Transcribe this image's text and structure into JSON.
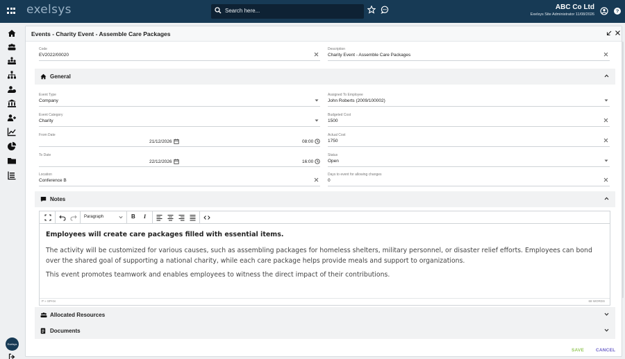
{
  "topbar": {
    "logo": "exelsys",
    "search_placeholder": "Search here...",
    "company_name": "ABC Co Ltd",
    "user_line": "Exelsys Site Administrator 11/08/2026"
  },
  "sidebar": {
    "items": [
      "home-icon",
      "team-icon",
      "org-icon",
      "hierarchy-icon",
      "user-group-icon",
      "bank-icon",
      "user-add-icon",
      "chart-line-icon",
      "pie-chart-icon",
      "folder-icon",
      "list-icon"
    ],
    "avatar_text": "Exelsys"
  },
  "panel": {
    "title": "Events - Charity Event - Assemble Care Packages"
  },
  "fields": {
    "code": {
      "label": "Code",
      "value": "EV2022/00020"
    },
    "description": {
      "label": "Description",
      "value": "Charity Event - Assemble Care Packages"
    },
    "event_type": {
      "label": "Event Type",
      "value": "Company"
    },
    "assigned_to": {
      "label": "Assigned To Employee",
      "value": "John Roberts (2009/100002)"
    },
    "event_category": {
      "label": "Event Category",
      "value": "Charity"
    },
    "budgeted_cost": {
      "label": "Budgeted Cost",
      "value": "1500"
    },
    "from_date": {
      "label": "From Date",
      "date": "21/12/2026",
      "time": "08:00"
    },
    "actual_cost": {
      "label": "Actual Cost",
      "value": "1750"
    },
    "to_date": {
      "label": "To Date",
      "date": "22/12/2026",
      "time": "16:00"
    },
    "status": {
      "label": "Status",
      "value": "Open"
    },
    "location": {
      "label": "Location",
      "value": "Conference B"
    },
    "days_to_event": {
      "label": "Days to event for allowing changes",
      "value": "0"
    }
  },
  "sections": {
    "general": "General",
    "notes": "Notes",
    "allocated": "Allocated Resources",
    "documents": "Documents"
  },
  "editor": {
    "paragraph_style": "Paragraph",
    "bold": "B",
    "italic": "I",
    "p1": "Employees will create care packages filled with essential items.",
    "p2": "The activity will be customized for various causes, such as assembling packages for homeless shelters, military personnel, or disaster relief efforts. Employees can bond over the shared goal of supporting a national charity, while each care package helps provide meals and support to organizations.",
    "p3": "This event promotes teamwork and enables employees to witness the direct impact of their contributions.",
    "path": "P » SPAN",
    "word_count": "68 WORDS"
  },
  "actions": {
    "save": "SAVE",
    "cancel": "CANCEL"
  },
  "colors": {
    "topbar": "#173a55",
    "save": "#97c95d",
    "cancel": "#6d62c9"
  }
}
